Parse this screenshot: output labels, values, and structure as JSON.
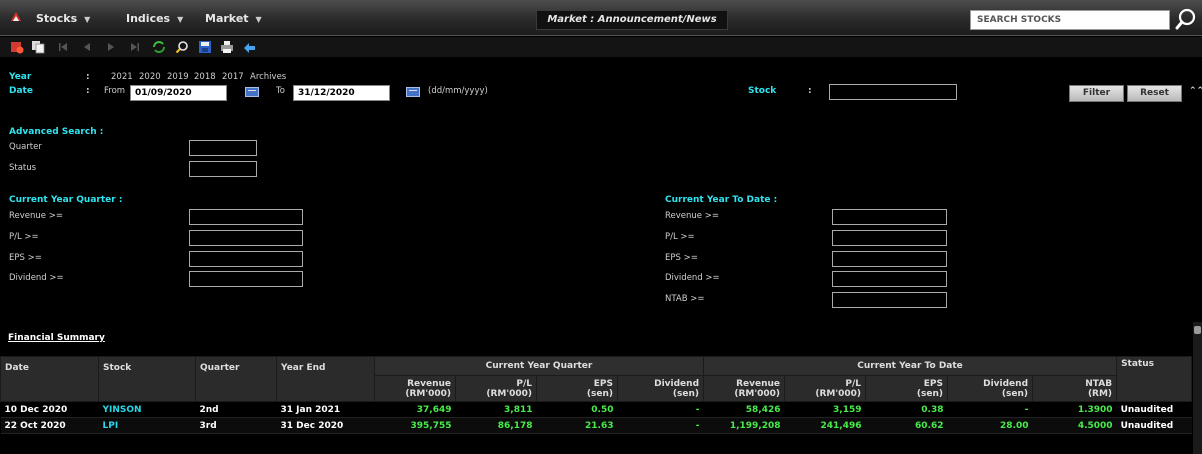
{
  "menubar": {
    "items": [
      {
        "label": "Stocks"
      },
      {
        "label": "Indices"
      },
      {
        "label": "Market"
      }
    ],
    "page_title": "Market : Announcement/News",
    "search_placeholder": "SEARCH STOCKS"
  },
  "toolbar_icons": [
    "stop-icon",
    "copy-icon",
    "first-icon",
    "prev-icon",
    "next-icon",
    "last-icon",
    "refresh-icon",
    "find-icon",
    "save-icon",
    "print-icon",
    "back-icon"
  ],
  "filters": {
    "year_label": "Year",
    "date_label": "Date",
    "colon": ":",
    "years": [
      "2021",
      "2020",
      "2019",
      "2018",
      "2017",
      "Archives"
    ],
    "from_label": "From",
    "from_value": "01/09/2020",
    "to_label": "To",
    "to_value": "31/12/2020",
    "date_format_hint": "(dd/mm/yyyy)",
    "stock_label": "Stock",
    "stock_value": "",
    "filter_button": "Filter",
    "reset_button": "Reset"
  },
  "advanced_search": {
    "title": "Advanced Search :",
    "fields": [
      "Quarter",
      "Status"
    ]
  },
  "current_year_quarter": {
    "title": "Current Year Quarter :",
    "fields": [
      "Revenue >=",
      "P/L >=",
      "EPS >=",
      "Dividend >="
    ]
  },
  "current_year_to_date": {
    "title": "Current Year To Date :",
    "fields": [
      "Revenue >=",
      "P/L >=",
      "EPS >=",
      "Dividend  >=",
      "NTAB >="
    ]
  },
  "financial_summary": {
    "title": "Financial Summary",
    "headers": {
      "date": "Date",
      "stock": "Stock",
      "quarter": "Quarter",
      "year_end": "Year End",
      "cyq_group": "Current Year Quarter",
      "cytd_group": "Current Year To Date",
      "status": "Status",
      "revenue_1": "Revenue",
      "revenue_2": "(RM'000)",
      "pl_1": "P/L",
      "pl_2": "(RM'000)",
      "eps_1": "EPS",
      "eps_2": "(sen)",
      "div_1": "Dividend",
      "div_2": "(sen)",
      "ntab_1": "NTAB",
      "ntab_2": "(RM)"
    },
    "rows": [
      {
        "date": "10 Dec 2020",
        "stock": "YINSON",
        "quarter": "2nd",
        "year_end": "31 Jan 2021",
        "q_revenue": "37,649",
        "q_pl": "3,811",
        "q_eps": "0.50",
        "q_div": "-",
        "ytd_revenue": "58,426",
        "ytd_pl": "3,159",
        "ytd_eps": "0.38",
        "ytd_div": "-",
        "ntab": "1.3900",
        "status": "Unaudited"
      },
      {
        "date": "22 Oct 2020",
        "stock": "LPI",
        "quarter": "3rd",
        "year_end": "31 Dec 2020",
        "q_revenue": "395,755",
        "q_pl": "86,178",
        "q_eps": "21.63",
        "q_div": "-",
        "ytd_revenue": "1,199,208",
        "ytd_pl": "241,496",
        "ytd_eps": "60.62",
        "ytd_div": "28.00",
        "ntab": "4.5000",
        "status": "Unaudited"
      }
    ]
  }
}
